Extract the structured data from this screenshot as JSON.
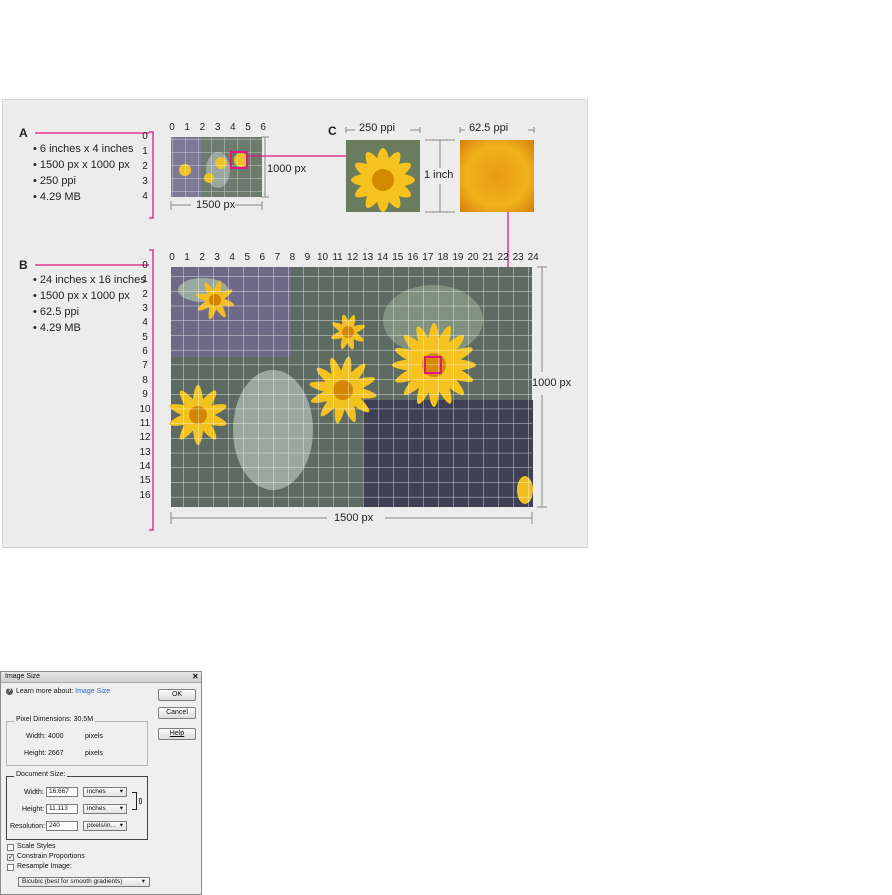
{
  "figure": {
    "a": {
      "letter": "A",
      "bullets": [
        "• 6 inches x 4 inches",
        "• 1500 px x 1000 px",
        "• 250 ppi",
        "• 4.29 MB"
      ],
      "ruler_top": [
        "0",
        "1",
        "2",
        "3",
        "4",
        "5",
        "6"
      ],
      "ruler_left": [
        "0",
        "1",
        "2",
        "3",
        "4"
      ],
      "height_label": "1000 px",
      "width_label": "1500 px"
    },
    "c": {
      "letter": "C",
      "label_left": "250 ppi",
      "label_right": "62.5 ppi",
      "inch_label": "1 inch"
    },
    "b": {
      "letter": "B",
      "bullets": [
        "• 24 inches x 16 inches",
        "• 1500 px x 1000 px",
        "• 62.5 ppi",
        "• 4.29 MB"
      ],
      "ruler_top": [
        "0",
        "1",
        "2",
        "3",
        "4",
        "5",
        "6",
        "7",
        "8",
        "9",
        "10",
        "11",
        "12",
        "13",
        "14",
        "15",
        "16",
        "17",
        "18",
        "19",
        "20",
        "21",
        "22",
        "23",
        "24"
      ],
      "ruler_left": [
        "0",
        "1",
        "2",
        "3",
        "4",
        "5",
        "6",
        "7",
        "8",
        "9",
        "10",
        "11",
        "12",
        "13",
        "14",
        "15",
        "16"
      ],
      "height_label": "1000 px",
      "width_label": "1500 px"
    },
    "accent": "#e0197d"
  },
  "dialog": {
    "title": "Image Size",
    "learn_prefix": "Learn more about:",
    "learn_link": "Image Size",
    "buttons": {
      "ok": "OK",
      "cancel": "Cancel",
      "help": "Help"
    },
    "pixel_dimensions": {
      "legend": "Pixel Dimensions: 30.5M",
      "width_label": "Width:",
      "width_value": "4000",
      "width_unit": "pixels",
      "height_label": "Height:",
      "height_value": "2667",
      "height_unit": "pixels"
    },
    "document_size": {
      "legend": "Document Size:",
      "width_label": "Width:",
      "width_value": "16.667",
      "width_unit": "inches",
      "height_label": "Height:",
      "height_value": "11.113",
      "height_unit": "inches",
      "resolution_label": "Resolution:",
      "resolution_value": "240",
      "resolution_unit": "pixels/in..."
    },
    "scale_styles": {
      "label": "Scale Styles",
      "checked": false
    },
    "constrain": {
      "label": "Constrain Proportions",
      "checked": true
    },
    "resample": {
      "label": "Resample Image:",
      "checked": false
    },
    "resample_method": "Bicubic (best for smooth gradients)",
    "link_color": "#1f6fd1"
  }
}
